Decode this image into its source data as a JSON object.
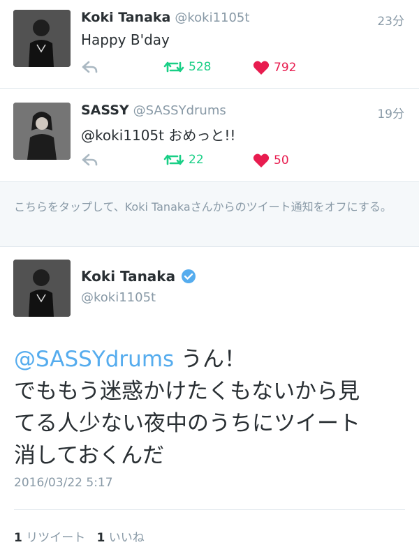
{
  "tweets": [
    {
      "name": "Koki Tanaka",
      "handle": "@koki1105t",
      "time": "23分",
      "text": "Happy B'day",
      "retweets": "528",
      "likes": "792"
    },
    {
      "name": "SASSY",
      "handle": "@SASSYdrums",
      "time": "19分",
      "text": "@koki1105t おめっと!!",
      "retweets": "22",
      "likes": "50"
    }
  ],
  "notice": "こちらをタップして、Koki Tanakaさんからのツイート通知をオフにする。",
  "detail": {
    "name": "Koki Tanaka",
    "handle": "@koki1105t",
    "mention": "@SASSYdrums",
    "text_after_mention": " うん！",
    "text_lines": [
      "でももう迷惑かけたくもないから見",
      "てる人少ない夜中のうちにツイート",
      "消しておくんだ"
    ],
    "timestamp": "2016/03/22 5:17",
    "retweet_count": "1",
    "retweet_label": "リツイート",
    "like_count": "1",
    "like_label": "いいね"
  },
  "colors": {
    "retweet": "#19cf86",
    "like": "#e81c4f",
    "mention": "#55acee",
    "muted": "#8899a6"
  },
  "icons": {
    "reply": "reply-icon",
    "retweet": "retweet-icon",
    "like": "heart-icon",
    "verified": "verified-badge-icon"
  }
}
